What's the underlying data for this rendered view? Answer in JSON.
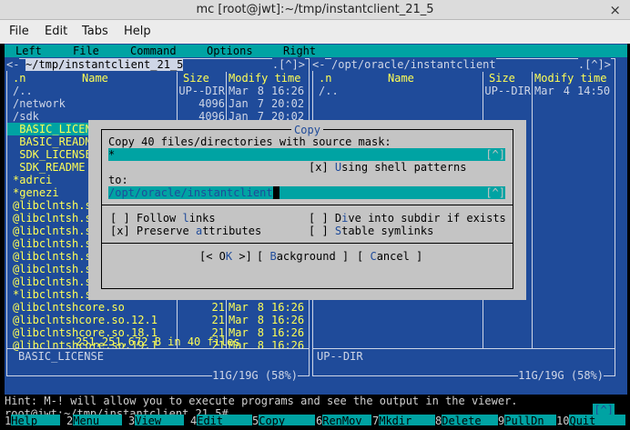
{
  "window": {
    "title": "mc [root@jwt]:~/tmp/instantclient_21_5",
    "close_glyph": "×"
  },
  "menubar": {
    "items": [
      "File",
      "Edit",
      "Tabs",
      "Help"
    ]
  },
  "mc_menu": {
    "items": [
      "Left",
      "File",
      "Command",
      "Options",
      "Right"
    ]
  },
  "left_panel": {
    "path": " ~/tmp/instantclient_21_5 ",
    "left_corner": "<-",
    "right_corner": ".[^]>",
    "headers": {
      "n": ".n",
      "name": "Name",
      "size": "Size",
      "mtime": "Modify time"
    },
    "rows": [
      {
        "name": "/..",
        "size": "UP--DIR",
        "month": "Mar",
        "day": "8",
        "time": "16:26"
      },
      {
        "name": "/network",
        "size": "4096",
        "month": "Jan",
        "day": "7",
        "time": "20:02"
      },
      {
        "name": "/sdk",
        "size": "4096",
        "month": "Jan",
        "day": "7",
        "time": "20:02"
      },
      {
        "name": " BASIC_LICENSE",
        "size": "",
        "month": "",
        "day": "",
        "time": ""
      },
      {
        "name": " BASIC_README",
        "size": "",
        "month": "",
        "day": "",
        "time": ""
      },
      {
        "name": " SDK_LICENSE",
        "size": "",
        "month": "",
        "day": "",
        "time": ""
      },
      {
        "name": " SDK_README",
        "size": "",
        "month": "",
        "day": "",
        "time": ""
      },
      {
        "name": "*adrci",
        "size": "",
        "month": "",
        "day": "",
        "time": ""
      },
      {
        "name": "*genezi",
        "size": "",
        "month": "",
        "day": "",
        "time": ""
      },
      {
        "name": "@libclntsh.so",
        "size": "",
        "month": "",
        "day": "",
        "time": ""
      },
      {
        "name": "@libclntsh.so",
        "size": "",
        "month": "",
        "day": "",
        "time": ""
      },
      {
        "name": "@libclntsh.so",
        "size": "",
        "month": "",
        "day": "",
        "time": ""
      },
      {
        "name": "@libclntsh.so",
        "size": "",
        "month": "",
        "day": "",
        "time": ""
      },
      {
        "name": "@libclntsh.so",
        "size": "",
        "month": "",
        "day": "",
        "time": ""
      },
      {
        "name": "@libclntsh.so",
        "size": "",
        "month": "",
        "day": "",
        "time": ""
      },
      {
        "name": "@libclntsh.so",
        "size": "",
        "month": "",
        "day": "",
        "time": ""
      },
      {
        "name": "*libclntsh.so",
        "size": "",
        "month": "",
        "day": "",
        "time": ""
      },
      {
        "name": "@libclntshcore.so",
        "size": "21",
        "month": "Mar",
        "day": "8",
        "time": "16:26"
      },
      {
        "name": "@libclntshcore.so.12.1",
        "size": "21",
        "month": "Mar",
        "day": "8",
        "time": "16:26"
      },
      {
        "name": "@libclntshcore.so.18.1",
        "size": "21",
        "month": "Mar",
        "day": "8",
        "time": "16:26"
      },
      {
        "name": "@libclntshcore.so.19.1",
        "size": "21",
        "month": "Mar",
        "day": "8",
        "time": "16:26"
      }
    ],
    "summary": "251,251,672 B in 40 files",
    "status": "BASIC_LICENSE",
    "disk": "11G/19G (58%)"
  },
  "right_panel": {
    "path": " /opt/oracle/instantclient ",
    "left_corner": "<-",
    "right_corner": ".[^]>",
    "headers": {
      "n": ".n",
      "name": "Name",
      "size": "Size",
      "mtime": "Modify time"
    },
    "rows": [
      {
        "name": "/..",
        "size": "UP--DIR",
        "month": "Mar",
        "day": "4",
        "time": "14:50"
      }
    ],
    "status": "UP--DIR",
    "disk": "11G/19G (58%)"
  },
  "dialog": {
    "title": "Copy",
    "prompt": "Copy 40 files/directories with source mask:",
    "source_mask": "*",
    "history_glyph": "[^]",
    "shell_patterns": {
      "box": "[x]",
      "pre": "U",
      "rest": "sing shell patterns"
    },
    "to_label": "to:",
    "target": "/opt/oracle/instantclient",
    "follow_links": {
      "box": "[ ]",
      "a": "Follow ",
      "hot": "l",
      "b": "inks"
    },
    "preserve_attrs": {
      "box": "[x]",
      "a": "Preserve ",
      "hot": "a",
      "b": "ttributes"
    },
    "dive_subdir": {
      "box": "[ ]",
      "a": "D",
      "hot": "i",
      "b": "ve into subdir if exists"
    },
    "stable_symlinks": {
      "box": "[ ]",
      "a": "",
      "hot": "S",
      "b": "table symlinks"
    },
    "ok_button": "[< O",
    "ok_hot": "K",
    "ok_end": " >]",
    "background_button": "[ ",
    "background_hot": "B",
    "background_end": "ackground ]",
    "cancel_button": "[ ",
    "cancel_hot": "C",
    "cancel_end": "ancel ]"
  },
  "hint": "Hint: M-! will allow you to execute programs and see the output in the viewer.",
  "prompt": "root@jwt:~/tmp/instantclient_21_5#",
  "cmd_history": "[^]",
  "fkeys": [
    {
      "num": "1",
      "label": "Help"
    },
    {
      "num": "2",
      "label": "Menu"
    },
    {
      "num": "3",
      "label": "View"
    },
    {
      "num": "4",
      "label": "Edit"
    },
    {
      "num": "5",
      "label": "Copy"
    },
    {
      "num": "6",
      "label": "RenMov"
    },
    {
      "num": "7",
      "label": "Mkdir"
    },
    {
      "num": "8",
      "label": "Delete"
    },
    {
      "num": "9",
      "label": "PullDn"
    },
    {
      "num": "10",
      "label": "Quit"
    }
  ],
  "colors": {
    "panel_bg": "#1f4b9a",
    "cyan": "#00a3a3",
    "yellow": "#ffff55",
    "dialog_bg": "#c4c4c4"
  }
}
